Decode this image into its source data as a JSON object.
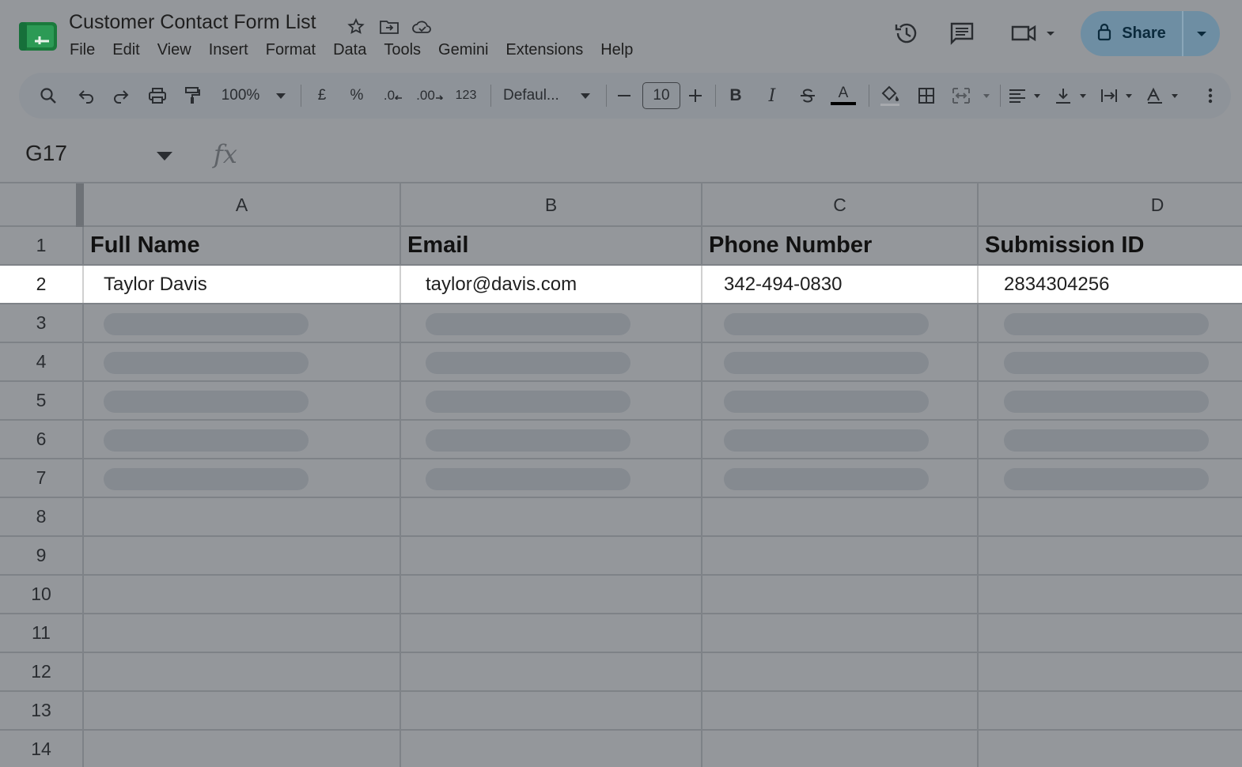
{
  "app": {
    "doc_title": "Customer Contact Form List"
  },
  "menu": [
    "File",
    "Edit",
    "View",
    "Insert",
    "Format",
    "Data",
    "Tools",
    "Gemini",
    "Extensions",
    "Help"
  ],
  "share": {
    "label": "Share"
  },
  "toolbar": {
    "zoom": "100%",
    "currency": "£",
    "percent": "%",
    "decrease_decimal": ".0",
    "increase_decimal": ".00",
    "number_format": "123",
    "font": "Defaul...",
    "font_size": "10",
    "bold": "B",
    "italic": "I",
    "text_color_glyph": "A"
  },
  "formula_bar": {
    "name_box": "G17",
    "fx_label": "fx"
  },
  "sheet": {
    "columns": [
      "A",
      "B",
      "C",
      "D"
    ],
    "row_numbers": [
      "1",
      "2",
      "3",
      "4",
      "5",
      "6",
      "7",
      "8",
      "9",
      "10",
      "11",
      "12",
      "13",
      "14"
    ],
    "header_row": [
      "Full Name",
      "Email",
      "Phone Number",
      "Submission ID"
    ],
    "data_row": [
      "Taylor Davis",
      "taylor@davis.com",
      "342-494-0830",
      "2834304256"
    ]
  },
  "colors": {
    "overlay_gray": "#94979b",
    "highlight_row": "#ffffff",
    "share_button": "#6e8ea3",
    "logo_green": "#188038"
  }
}
